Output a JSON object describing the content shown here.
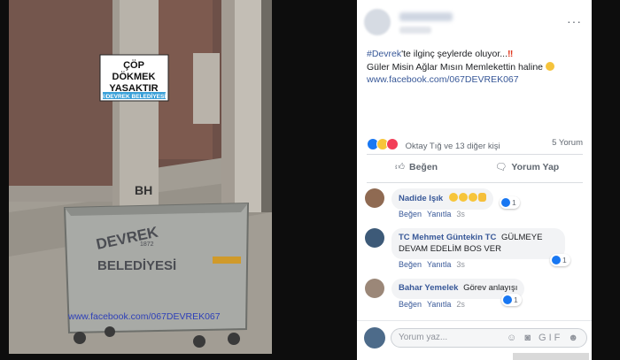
{
  "photo": {
    "sign_line1": "ÇÖP",
    "sign_line2": "DÖKMEK",
    "sign_line3": "YASAKTIR",
    "sign_strip": "©DEVREK BELEDİYESİ",
    "bin_text1": "DEVREK",
    "bin_year": "1872",
    "bin_text2": "BELEDİYESİ",
    "watermark": "www.facebook.com/067DEVREK067",
    "pole_graffiti": "BH"
  },
  "post": {
    "more_label": "···",
    "hashtag": "#Devrek",
    "line1_rest": "'te ilginç şeylerde oluyor...",
    "line1_mark": "‼",
    "line2": "Güler Misin Ağlar Mısın Memlekettin haline",
    "link": "www.facebook.com/067DEVREK067",
    "reactions_summary": "Oktay Tığ ve 13 diğer kişi",
    "comment_count": "5 Yorum",
    "like_label": "Beğen",
    "comment_label": "Yorum Yap"
  },
  "comments": [
    {
      "name": "Nadide Işık",
      "text": "",
      "like": "Beğen",
      "reply": "Yanıtla",
      "time": "3s",
      "likes": "1"
    },
    {
      "name": "TC Mehmet Güntekin TC",
      "text": "GÜLMEYE DEVAM EDELİM BOS VER",
      "like": "Beğen",
      "reply": "Yanıtla",
      "time": "3s",
      "likes": "1"
    },
    {
      "name": "Bahar Yemelek",
      "text": "Görev anlayışı",
      "like": "Beğen",
      "reply": "Yanıtla",
      "time": "2s",
      "likes": "1"
    }
  ],
  "composer": {
    "placeholder": "Yorum yaz...",
    "tools": "☺ ◙ GIF ☻"
  },
  "colors": {
    "link": "#385898",
    "like_blue": "#1877f2",
    "bubble": "#f2f3f5"
  }
}
